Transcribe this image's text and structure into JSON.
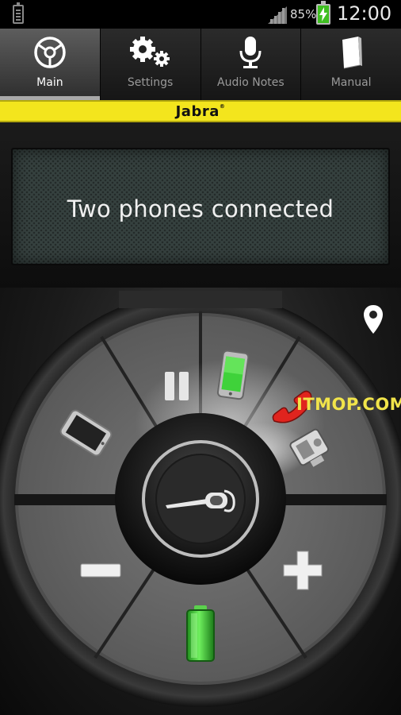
{
  "status_bar": {
    "battery_percent": "85%",
    "time": "12:00"
  },
  "tabs": [
    {
      "label": "Main",
      "icon": "radar-icon",
      "active": true
    },
    {
      "label": "Settings",
      "icon": "gears-icon",
      "active": false
    },
    {
      "label": "Audio Notes",
      "icon": "microphone-icon",
      "active": false
    },
    {
      "label": "Manual",
      "icon": "book-icon",
      "active": false
    }
  ],
  "brand": {
    "logo_text": "Jabra",
    "color": "#f3e51d"
  },
  "display": {
    "message": "Two phones connected"
  },
  "dial": {
    "segments": [
      {
        "name": "phone-1",
        "icon": "smartphone-icon"
      },
      {
        "name": "pause",
        "icon": "pause-icon"
      },
      {
        "name": "phone-2",
        "icon": "green-smartphone-icon"
      },
      {
        "name": "end-call",
        "icon": "red-handset-icon"
      },
      {
        "name": "car-kit",
        "icon": "car-kit-icon"
      },
      {
        "name": "volume-down",
        "icon": "minus-icon"
      },
      {
        "name": "battery",
        "icon": "battery-icon"
      },
      {
        "name": "volume-up",
        "icon": "plus-icon"
      }
    ],
    "center_icon": "headset-icon",
    "battery_level": 1.0,
    "accent_green": "#3fd23a",
    "accent_red": "#e0241e"
  },
  "watermark": "ITMOP.COM"
}
